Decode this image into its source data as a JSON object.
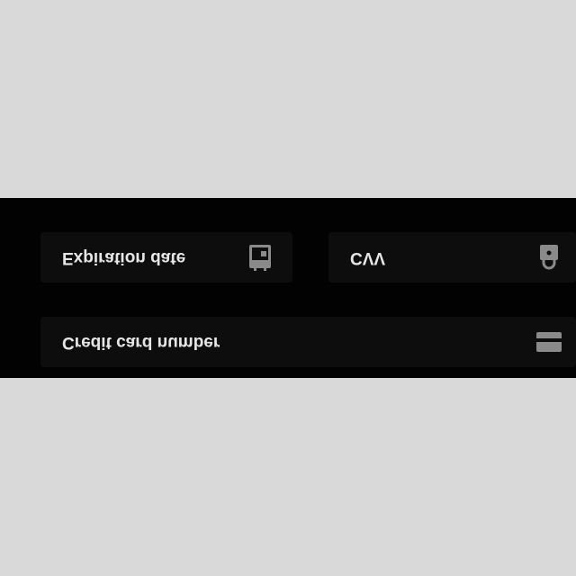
{
  "form": {
    "card_number": {
      "placeholder": "Credit card number",
      "icon": "credit-card-icon"
    },
    "expiration": {
      "placeholder": "Expiration date",
      "icon": "calendar-icon"
    },
    "cvv": {
      "placeholder": "CVV",
      "icon": "lock-icon"
    }
  },
  "colors": {
    "background": "#d9d9d9",
    "panel": "#020202",
    "field": "#0d0d0d",
    "text": "#e6e6e6",
    "icon": "#8a8a8a"
  }
}
